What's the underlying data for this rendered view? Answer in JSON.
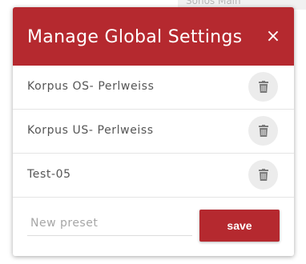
{
  "background": {
    "partial_text": "Sonos Main"
  },
  "modal": {
    "title": "Manage Global Settings",
    "close_symbol": "×",
    "presets": [
      {
        "label": "Korpus OS- Perlweiss"
      },
      {
        "label": "Korpus US- Perlweiss"
      },
      {
        "label": "Test-05"
      }
    ],
    "new_preset_placeholder": "New preset",
    "save_label": "save"
  },
  "colors": {
    "header_bg": "#b5292f",
    "button_bg": "#b5292f",
    "delete_circle_bg": "#ececec",
    "icon_gray": "#7a7a7a"
  },
  "icons": {
    "close": "close-icon",
    "delete": "trash-icon"
  }
}
